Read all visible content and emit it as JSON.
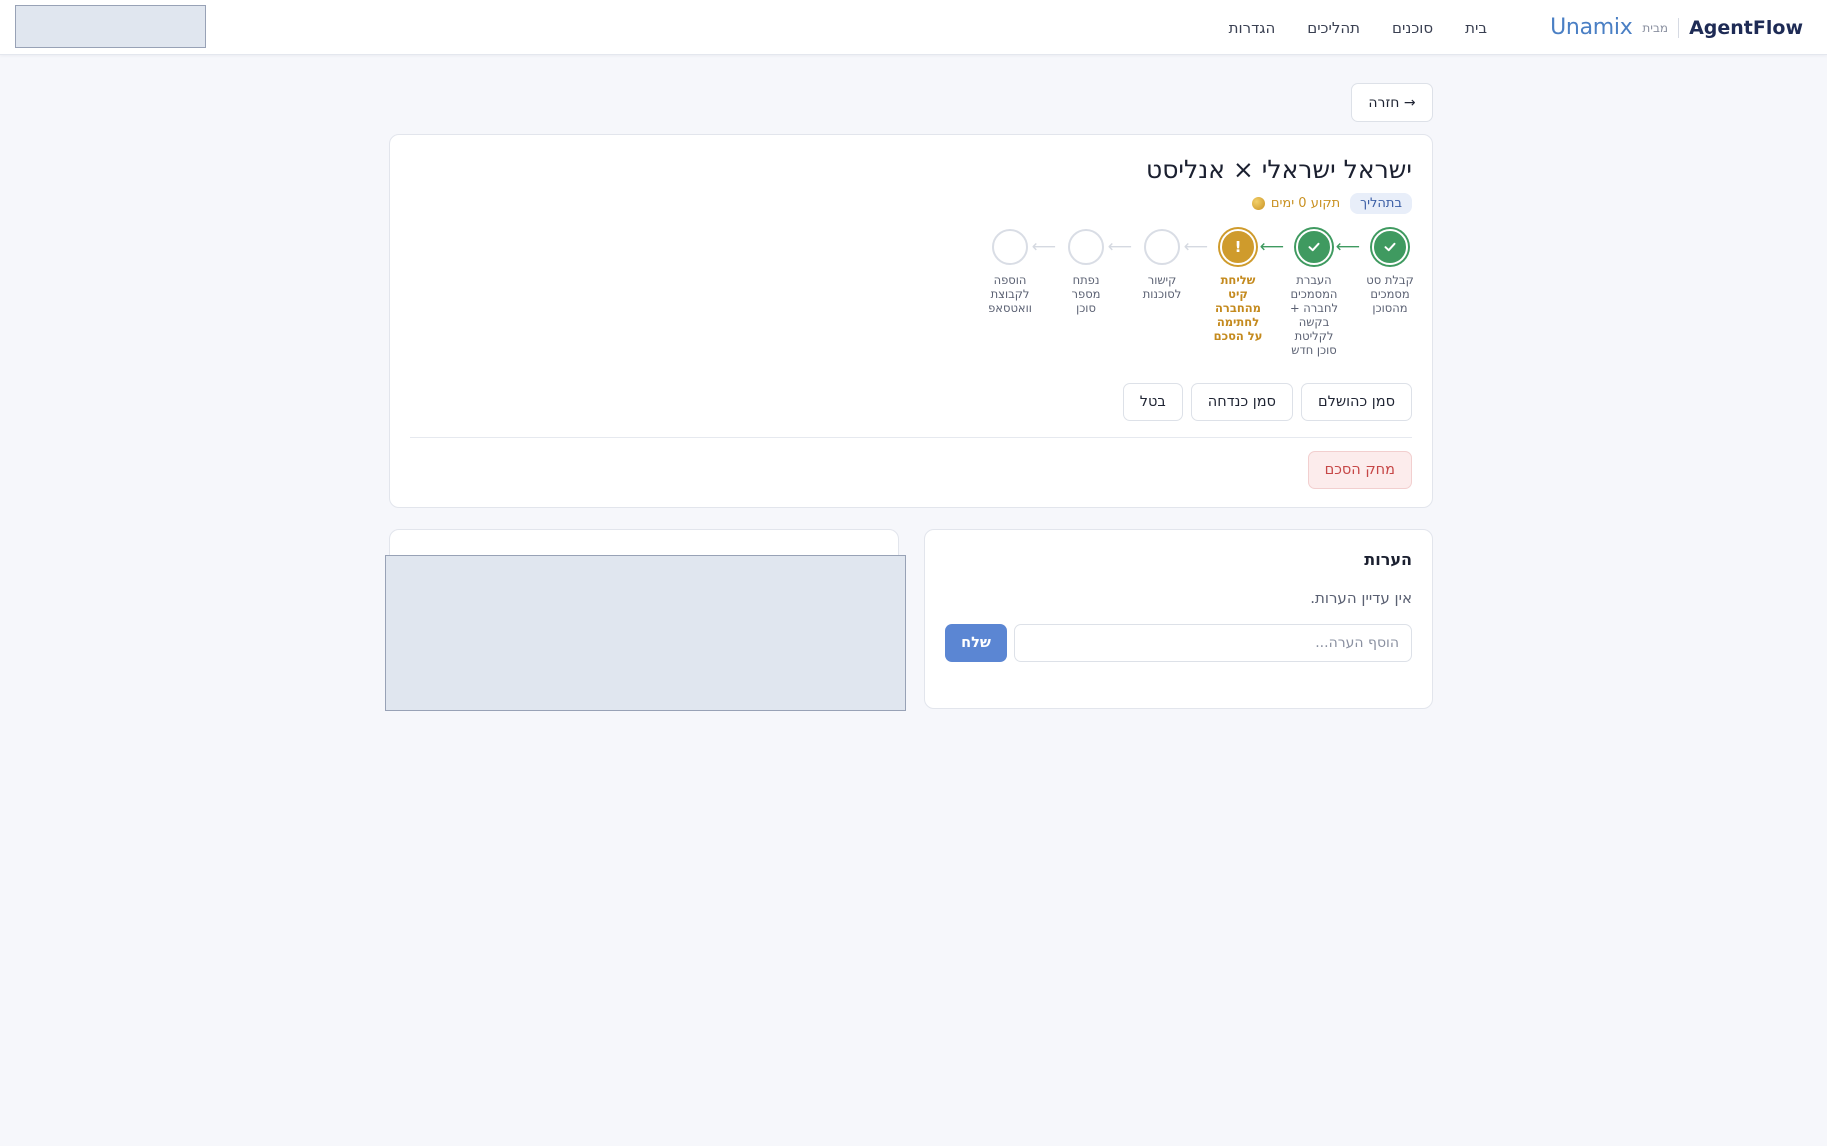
{
  "brand": {
    "name": "AgentFlow",
    "by": "מבית",
    "partner": "Unamix"
  },
  "nav": {
    "items": [
      {
        "label": "בית"
      },
      {
        "label": "סוכנים"
      },
      {
        "label": "תהליכים"
      },
      {
        "label": "הגדרות"
      }
    ]
  },
  "back": {
    "label": "→ חזרה"
  },
  "process": {
    "title": "ישראל ישראלי × אנליסט",
    "status_badge": "בתהליך",
    "stuck_text": "תקוע 0 ימים",
    "status_colors": {
      "done": "#3f9a60",
      "warning": "#cf9b2c",
      "pending": "#d9dde5"
    },
    "steps": [
      {
        "label": "קבלת סט מסמכים מהסוכן",
        "state": "done"
      },
      {
        "label": "העברת המסמכים לחברה + בקשה לקליטת סוכן חדש",
        "state": "done"
      },
      {
        "label": "שליחת קיט מהחברה לחתימה על הסכם",
        "state": "warning",
        "icon": "!"
      },
      {
        "label": "קישור לסוכנות",
        "state": "pending"
      },
      {
        "label": "נפתח מספר סוכן",
        "state": "pending"
      },
      {
        "label": "הוספה לקבוצת וואטסאפ",
        "state": "pending"
      }
    ],
    "actions": {
      "complete": "סמן כהושלם",
      "reject": "סמן כנדחה",
      "cancel": "בטל"
    },
    "delete_label": "מחק הסכם"
  },
  "comments": {
    "title": "הערות",
    "empty_text": "אין עדיין הערות.",
    "input_placeholder": "הוסף הערה...",
    "send_label": "שלח"
  }
}
